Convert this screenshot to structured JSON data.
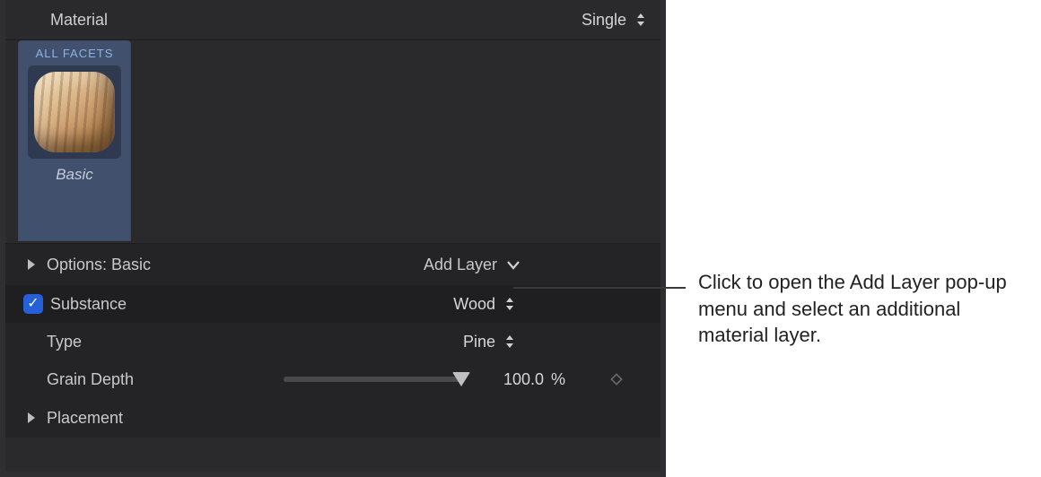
{
  "header": {
    "material_label": "Material",
    "material_mode": "Single"
  },
  "facet": {
    "title": "ALL FACETS",
    "swatch_name": "Basic"
  },
  "params": {
    "options_label": "Options: Basic",
    "add_layer_label": "Add Layer",
    "substance": {
      "label": "Substance",
      "value": "Wood",
      "checked": true
    },
    "type": {
      "label": "Type",
      "value": "Pine"
    },
    "grain_depth": {
      "label": "Grain Depth",
      "value": "100.0",
      "unit": "%",
      "percent": 100
    },
    "placement_label": "Placement"
  },
  "callout": {
    "text": "Click to open the Add Layer pop-up menu and select an additional material layer."
  }
}
